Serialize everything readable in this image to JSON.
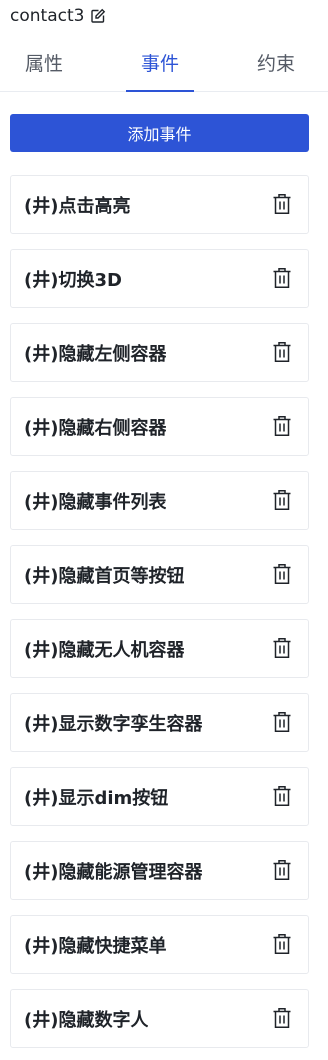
{
  "header": {
    "title": "contact3",
    "edit_icon": "edit-icon"
  },
  "tabs": [
    {
      "label": "属性",
      "active": false
    },
    {
      "label": "事件",
      "active": true
    },
    {
      "label": "约束",
      "active": false
    }
  ],
  "add_button": {
    "label": "添加事件"
  },
  "events": [
    {
      "label": "(井)点击高亮"
    },
    {
      "label": "(井)切换3D"
    },
    {
      "label": "(井)隐藏左侧容器"
    },
    {
      "label": "(井)隐藏右侧容器"
    },
    {
      "label": "(井)隐藏事件列表"
    },
    {
      "label": "(井)隐藏首页等按钮"
    },
    {
      "label": "(井)隐藏无人机容器"
    },
    {
      "label": "(井)显示数字孪生容器"
    },
    {
      "label": "(井)显示dim按钮"
    },
    {
      "label": "(井)隐藏能源管理容器"
    },
    {
      "label": "(井)隐藏快捷菜单"
    },
    {
      "label": "(井)隐藏数字人"
    }
  ],
  "colors": {
    "accent": "#2d54d6",
    "text": "#1f2329",
    "border": "#e8eaee"
  },
  "icons": {
    "delete": "trash-icon",
    "edit": "edit-icon"
  }
}
